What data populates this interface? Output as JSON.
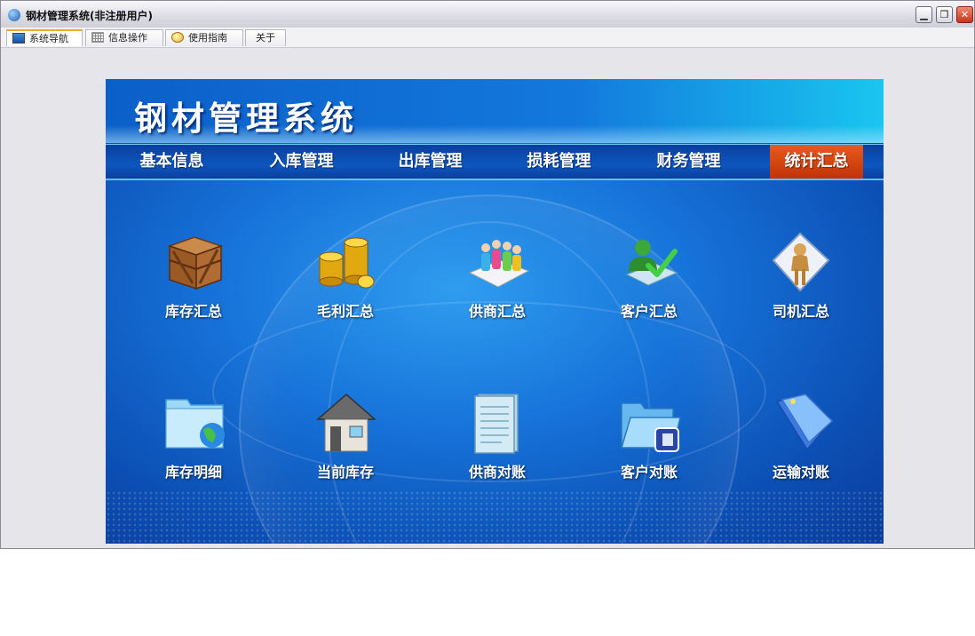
{
  "window": {
    "title": "钢材管理系统(非注册用户)",
    "controls": {
      "minimize": "▁",
      "restore": "❐",
      "close": "✕"
    }
  },
  "tabs": [
    {
      "label": "系统导航",
      "icon": "monitor-icon",
      "active": true
    },
    {
      "label": "信息操作",
      "icon": "grid-icon",
      "active": false
    },
    {
      "label": "使用指南",
      "icon": "guide-icon",
      "active": false
    },
    {
      "label": "关于",
      "icon": "",
      "active": false
    }
  ],
  "panel": {
    "title": "钢材管理系统",
    "nav": [
      {
        "label": "基本信息",
        "active": false
      },
      {
        "label": "入库管理",
        "active": false
      },
      {
        "label": "出库管理",
        "active": false
      },
      {
        "label": "损耗管理",
        "active": false
      },
      {
        "label": "财务管理",
        "active": false
      },
      {
        "label": "统计汇总",
        "active": true
      }
    ],
    "tiles": [
      {
        "label": "库存汇总",
        "icon": "wooden-crate-icon"
      },
      {
        "label": "毛利汇总",
        "icon": "gold-coins-icon"
      },
      {
        "label": "供商汇总",
        "icon": "people-group-icon"
      },
      {
        "label": "客户汇总",
        "icon": "user-check-icon"
      },
      {
        "label": "司机汇总",
        "icon": "driver-person-icon"
      },
      {
        "label": "库存明细",
        "icon": "folder-globe-icon"
      },
      {
        "label": "当前库存",
        "icon": "house-icon"
      },
      {
        "label": "供商对账",
        "icon": "document-icon"
      },
      {
        "label": "客户对账",
        "icon": "open-folder-icon"
      },
      {
        "label": "运输对账",
        "icon": "blue-folder-icon"
      }
    ]
  },
  "colors": {
    "nav_active": "#c23208",
    "panel_blue": "#1672d8",
    "tab_active_accent": "#f0a830"
  }
}
